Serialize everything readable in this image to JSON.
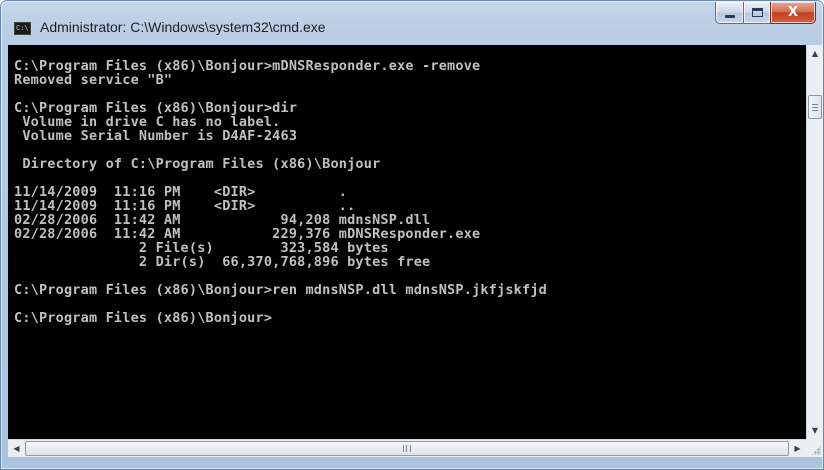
{
  "window": {
    "title": "Administrator: C:\\Windows\\system32\\cmd.exe",
    "icon": "cmd-console-icon",
    "icon_text": "C:\\"
  },
  "caption_buttons": {
    "minimize": "minimize-icon",
    "maximize": "maximize-icon",
    "close_label": "X"
  },
  "console": {
    "lines": [
      "",
      "C:\\Program Files (x86)\\Bonjour>mDNSResponder.exe -remove",
      "Removed service \"B\"",
      "",
      "C:\\Program Files (x86)\\Bonjour>dir",
      " Volume in drive C has no label.",
      " Volume Serial Number is D4AF-2463",
      "",
      " Directory of C:\\Program Files (x86)\\Bonjour",
      "",
      "11/14/2009  11:16 PM    <DIR>          .",
      "11/14/2009  11:16 PM    <DIR>          ..",
      "02/28/2006  11:42 AM            94,208 mdnsNSP.dll",
      "02/28/2006  11:42 AM           229,376 mDNSResponder.exe",
      "               2 File(s)        323,584 bytes",
      "               2 Dir(s)  66,370,768,896 bytes free",
      "",
      "C:\\Program Files (x86)\\Bonjour>ren mdnsNSP.dll mdnsNSP.jkfjskfjd",
      "",
      "C:\\Program Files (x86)\\Bonjour>"
    ],
    "text_color": "#C0C0C0",
    "background_color": "#000000"
  },
  "scrollbars": {
    "vertical": {
      "up_icon": "scroll-up-arrow-icon",
      "down_icon": "scroll-down-arrow-icon"
    },
    "horizontal": {
      "left_icon": "scroll-left-arrow-icon",
      "right_icon": "scroll-right-arrow-icon"
    }
  }
}
